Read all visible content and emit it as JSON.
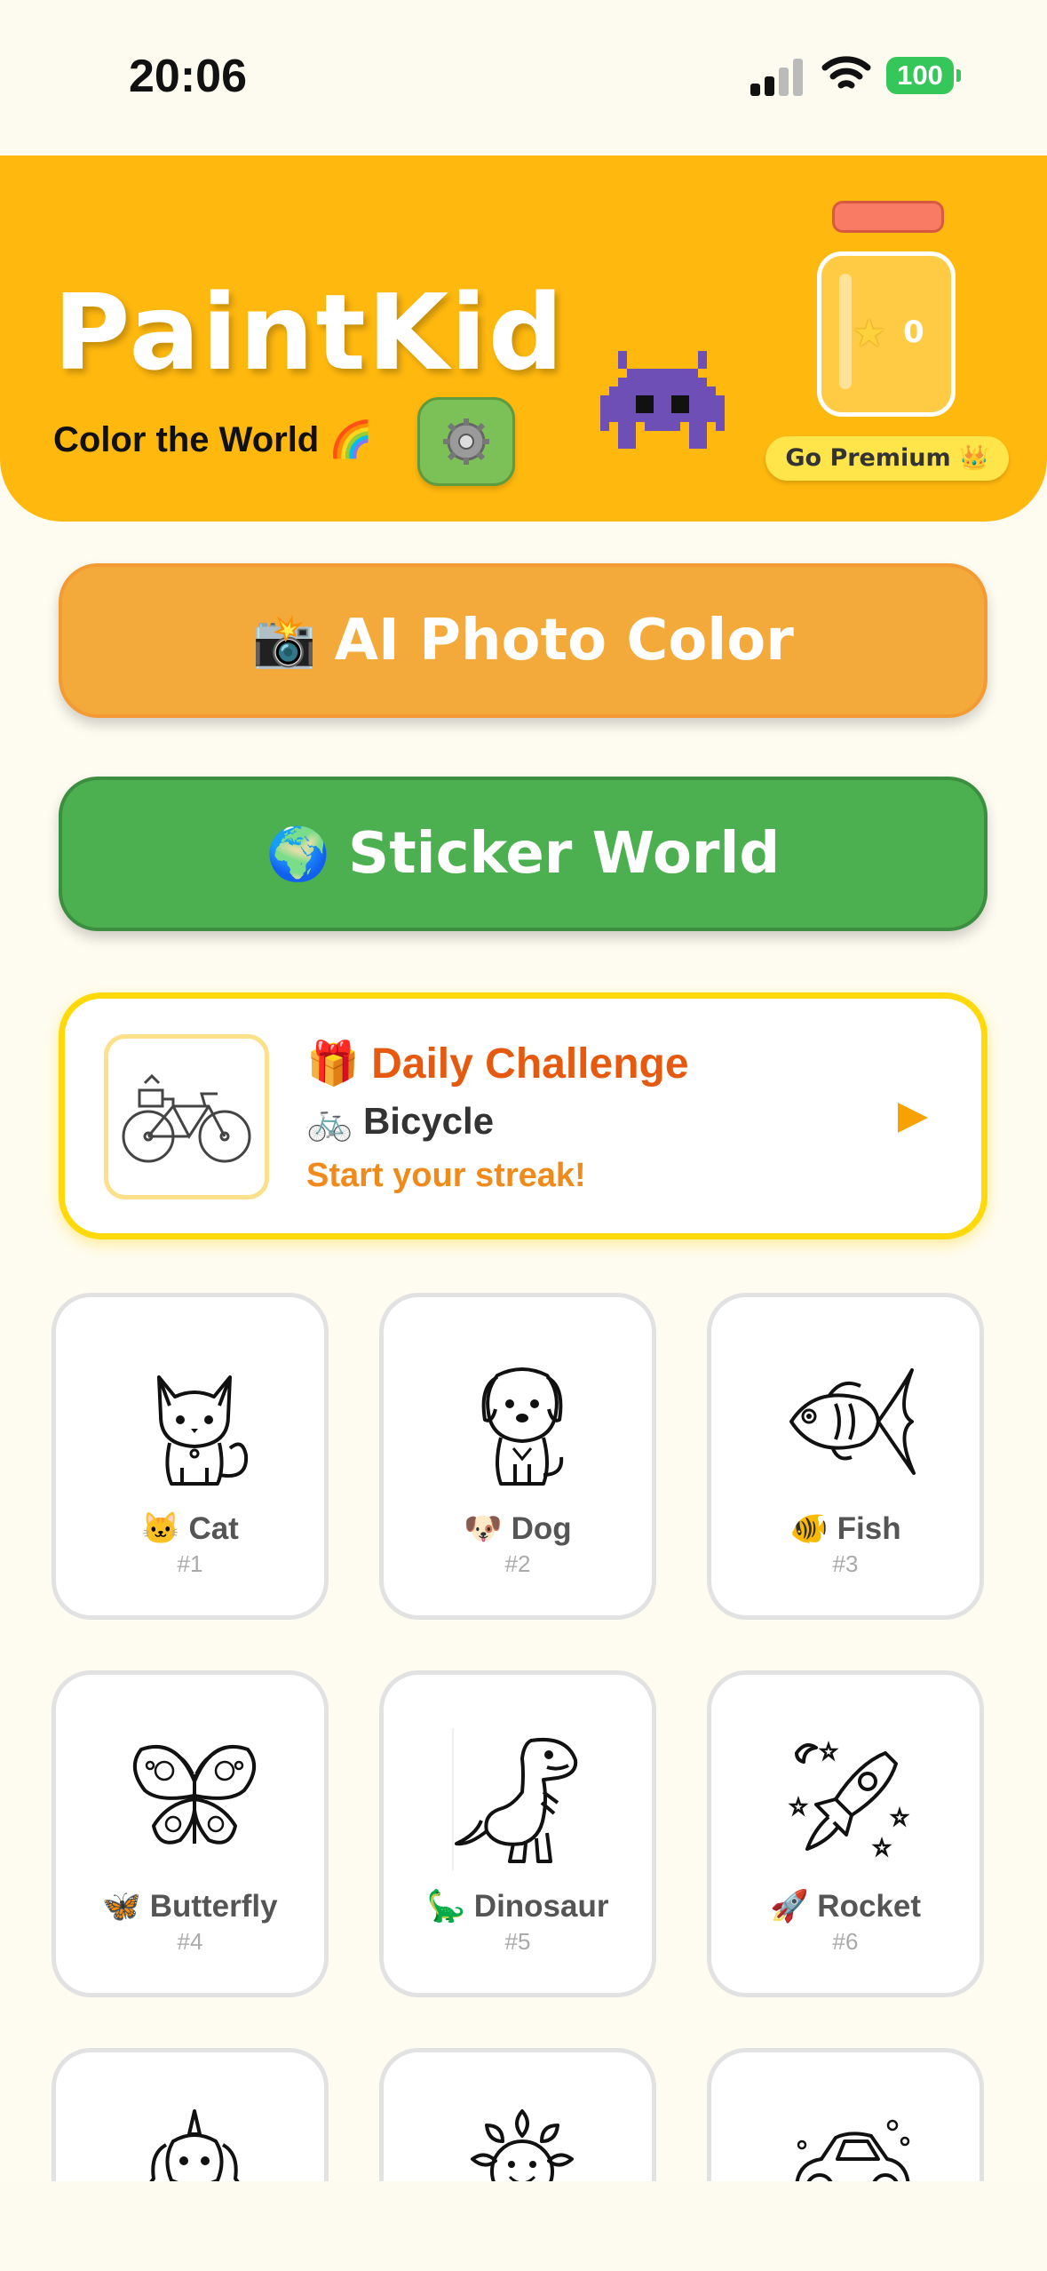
{
  "status_bar": {
    "time": "20:06",
    "battery": "100"
  },
  "header": {
    "title": "PaintKid",
    "tagline": "Color the World 🌈",
    "star_count": "0",
    "premium_label": "Go Premium 👑"
  },
  "actions": {
    "photo_emoji": "📸",
    "photo_label": "AI Photo Color",
    "sticker_emoji": "🌍",
    "sticker_label": "Sticker World"
  },
  "daily": {
    "title": "🎁 Daily Challenge",
    "subject": "🚲 Bicycle",
    "streak": "Start your streak!"
  },
  "pages": [
    {
      "name": "🐱 Cat",
      "num": "#1",
      "icon": "cat-icon"
    },
    {
      "name": "🐶 Dog",
      "num": "#2",
      "icon": "dog-icon"
    },
    {
      "name": "🐠 Fish",
      "num": "#3",
      "icon": "fish-icon"
    },
    {
      "name": "🦋 Butterfly",
      "num": "#4",
      "icon": "butterfly-icon"
    },
    {
      "name": "🦕 Dinosaur",
      "num": "#5",
      "icon": "dinosaur-icon"
    },
    {
      "name": "🚀 Rocket",
      "num": "#6",
      "icon": "rocket-icon"
    },
    {
      "name": "",
      "num": "",
      "icon": "unicorn-icon"
    },
    {
      "name": "",
      "num": "",
      "icon": "sunflower-icon"
    },
    {
      "name": "",
      "num": "",
      "icon": "car-icon"
    }
  ],
  "colors": {
    "header": "#FFB80E",
    "photo_button": "#F3AA3A",
    "sticker_button": "#4CAF50",
    "daily_border": "#FFD90A",
    "daily_title": "#E65A10"
  }
}
